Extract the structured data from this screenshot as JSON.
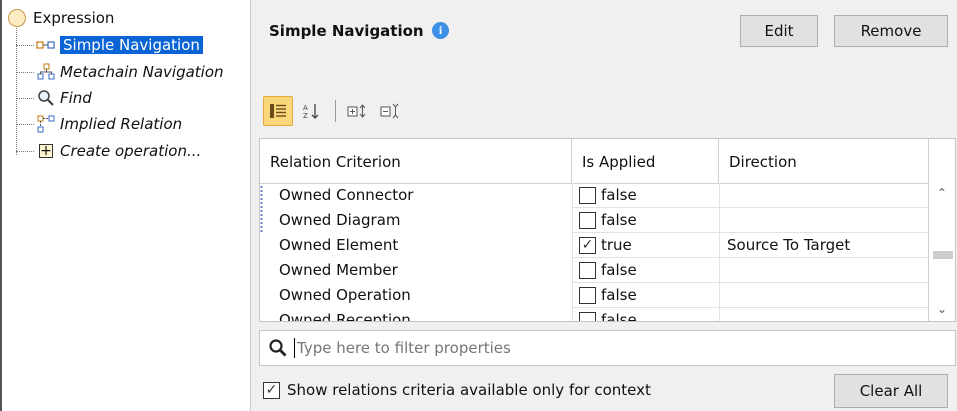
{
  "tree": {
    "root_label": "Expression",
    "items": [
      {
        "label": "Simple Navigation",
        "icon": "simple-navigation-icon",
        "selected": true
      },
      {
        "label": "Metachain Navigation",
        "icon": "metachain-navigation-icon",
        "selected": false
      },
      {
        "label": "Find",
        "icon": "find-icon",
        "selected": false
      },
      {
        "label": "Implied Relation",
        "icon": "implied-relation-icon",
        "selected": false
      },
      {
        "label": "Create operation...",
        "icon": "create-operation-icon",
        "selected": false
      }
    ]
  },
  "header": {
    "title": "Simple Navigation",
    "info_icon": "info-icon",
    "edit_label": "Edit",
    "remove_label": "Remove"
  },
  "toolbar": {
    "buttons": [
      "categorized-view-icon",
      "sort-alphabetically-icon",
      "expand-all-icon",
      "collapse-all-icon"
    ]
  },
  "table": {
    "columns": [
      "Relation Criterion",
      "Is Applied",
      "Direction"
    ],
    "rows": [
      {
        "criterion": "Owned Connector",
        "checked": false,
        "applied": "false",
        "direction": ""
      },
      {
        "criterion": "Owned Diagram",
        "checked": false,
        "applied": "false",
        "direction": ""
      },
      {
        "criterion": "Owned Element",
        "checked": true,
        "applied": "true",
        "direction": "Source To Target"
      },
      {
        "criterion": "Owned Member",
        "checked": false,
        "applied": "false",
        "direction": ""
      },
      {
        "criterion": "Owned Operation",
        "checked": false,
        "applied": "false",
        "direction": ""
      },
      {
        "criterion": "Owned Reception",
        "checked": false,
        "applied": "false",
        "direction": ""
      }
    ]
  },
  "filter": {
    "placeholder": "Type here to filter properties",
    "value": ""
  },
  "footer": {
    "context_checkbox_label": "Show relations criteria available only for context",
    "context_checked": true,
    "clear_all_label": "Clear All"
  },
  "colors": {
    "selection": "#0a64d6",
    "active_toolbar": "#fbd77c",
    "info": "#3e8fe6"
  }
}
